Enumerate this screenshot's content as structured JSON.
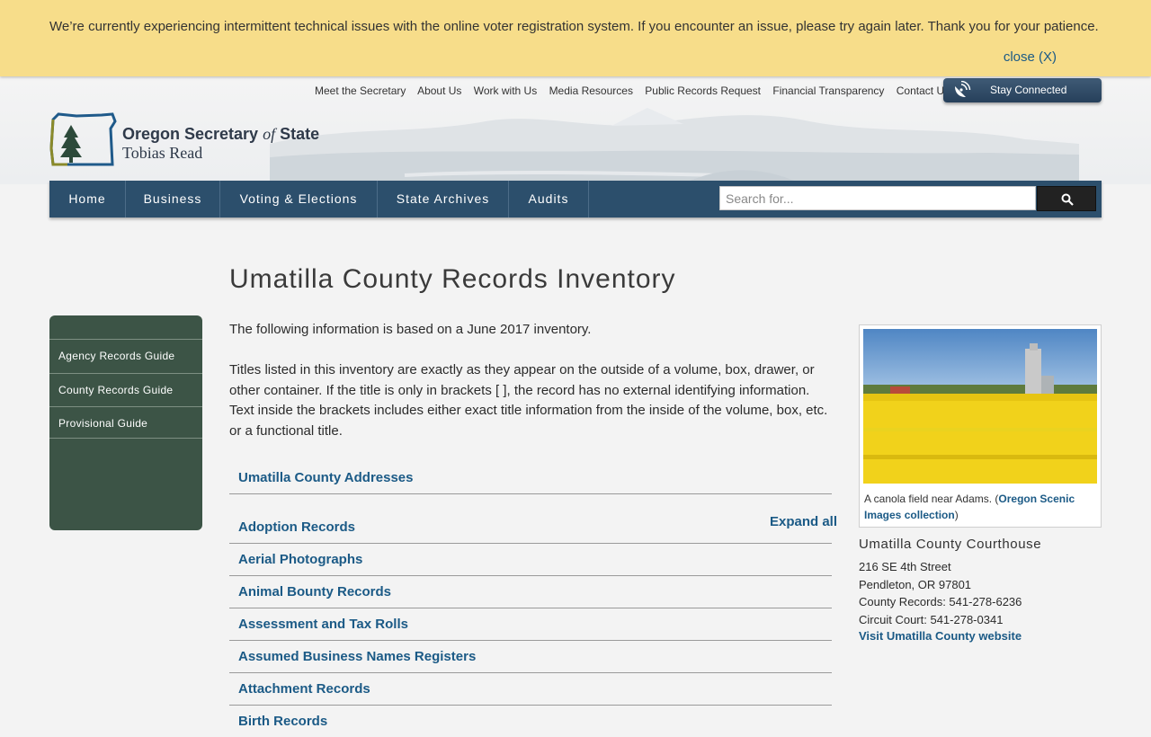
{
  "alert": {
    "message": "We’re currently experiencing intermittent technical issues with the online voter registration system. If you encounter an issue, please try again later. Thank you for your patience.",
    "close_label": "close (X)"
  },
  "utility_nav": [
    "Meet the Secretary",
    "About Us",
    "Work with Us",
    "Media Resources",
    "Public Records Request",
    "Financial Transparency",
    "Contact Us"
  ],
  "stay_connected": "Stay Connected",
  "logo": {
    "title_part1": "Oregon Secretary ",
    "title_part2": "of",
    "title_part3": " State",
    "subtitle": "Tobias Read"
  },
  "main_nav": [
    "Home",
    "Business",
    "Voting & Elections",
    "State Archives",
    "Audits"
  ],
  "search": {
    "placeholder": "Search for..."
  },
  "page_title": "Umatilla County Records Inventory",
  "sidebar": [
    "Agency Records Guide",
    "County Records Guide",
    "Provisional Guide"
  ],
  "intro_1": "The following information is based on a June 2017 inventory.",
  "intro_2": "Titles listed in this inventory are exactly as they appear on the outside of a volume, box, drawer, or other container. If the title is only in brackets [ ], the record has no external identifying information. Text inside the brackets includes either exact title information from the inside of the volume, box, etc. or a functional title.",
  "addresses_link": "Umatilla County Addresses",
  "expand_all": "Expand all",
  "accordion": [
    "Adoption Records",
    "Aerial Photographs",
    "Animal Bounty Records",
    "Assessment and Tax Rolls",
    "Assumed Business Names Registers",
    "Attachment Records",
    "Birth Records"
  ],
  "photo": {
    "caption_text": "A canola field near Adams. (",
    "caption_link": "Oregon Scenic Images collection",
    "caption_end": ")"
  },
  "courthouse": {
    "title": "Umatilla County Courthouse",
    "lines": [
      "216 SE 4th Street",
      "Pendleton, OR 97801",
      "County Records: 541-278-6236",
      "Circuit Court: 541-278-0341"
    ],
    "link": "Visit Umatilla County website"
  },
  "colors": {
    "nav_blue": "#2c4f6c",
    "sidebar_green": "#3c5446",
    "link_blue": "#1b5a86",
    "alert_yellow": "#f7dd8a"
  }
}
